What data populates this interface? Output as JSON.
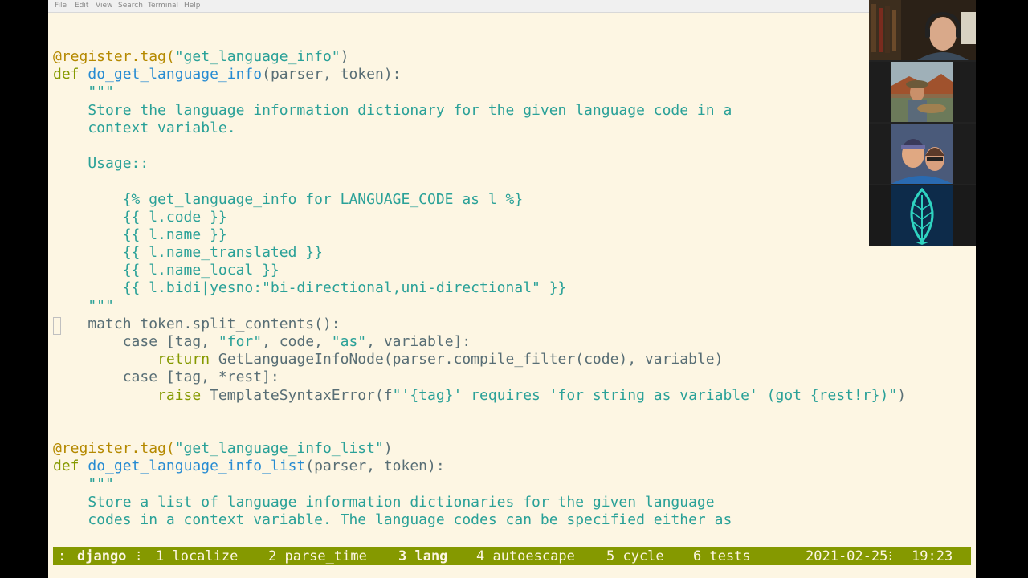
{
  "menu": [
    "File",
    "Edit",
    "View",
    "Search",
    "Terminal",
    "Help"
  ],
  "code_lines": [
    [
      {
        "t": "@register.tag(",
        "c": "dec"
      },
      {
        "t": "\"get_language_info\"",
        "c": "str"
      },
      {
        "t": ")",
        "c": ""
      }
    ],
    [
      {
        "t": "def ",
        "c": "kw"
      },
      {
        "t": "do_get_language_info",
        "c": "fn"
      },
      {
        "t": "(parser, token):",
        "c": ""
      }
    ],
    [
      {
        "t": "    \"\"\"",
        "c": "doc"
      }
    ],
    [
      {
        "t": "    Store the language information dictionary for the given language code in a",
        "c": "doc"
      }
    ],
    [
      {
        "t": "    context variable.",
        "c": "doc"
      }
    ],
    [
      {
        "t": "",
        "c": ""
      }
    ],
    [
      {
        "t": "    Usage::",
        "c": "doc"
      }
    ],
    [
      {
        "t": "",
        "c": ""
      }
    ],
    [
      {
        "t": "        {% get_language_info for LANGUAGE_CODE as l %}",
        "c": "doc"
      }
    ],
    [
      {
        "t": "        {{ l.code }}",
        "c": "doc"
      }
    ],
    [
      {
        "t": "        {{ l.name }}",
        "c": "doc"
      }
    ],
    [
      {
        "t": "        {{ l.name_translated }}",
        "c": "doc"
      }
    ],
    [
      {
        "t": "        {{ l.name_local }}",
        "c": "doc"
      }
    ],
    [
      {
        "t": "        {{ l.bidi|yesno:\"bi-directional,uni-directional\" }}",
        "c": "doc"
      }
    ],
    [
      {
        "t": "    \"\"\"",
        "c": "doc"
      }
    ],
    [
      {
        "t": "    match token.split_contents():",
        "c": ""
      }
    ],
    [
      {
        "t": "        case [tag, ",
        "c": ""
      },
      {
        "t": "\"for\"",
        "c": "str"
      },
      {
        "t": ", code, ",
        "c": ""
      },
      {
        "t": "\"as\"",
        "c": "str"
      },
      {
        "t": ", variable]:",
        "c": ""
      }
    ],
    [
      {
        "t": "            ",
        "c": ""
      },
      {
        "t": "return",
        "c": "kw"
      },
      {
        "t": " GetLanguageInfoNode(parser.compile_filter(code), variable)",
        "c": ""
      }
    ],
    [
      {
        "t": "        case [tag, *rest]:",
        "c": ""
      }
    ],
    [
      {
        "t": "            ",
        "c": ""
      },
      {
        "t": "raise",
        "c": "kw"
      },
      {
        "t": " TemplateSyntaxError(f",
        "c": ""
      },
      {
        "t": "\"'{tag}' requires 'for string as variable' (got {rest!r})\"",
        "c": "str"
      },
      {
        "t": ")",
        "c": ""
      }
    ],
    [
      {
        "t": "",
        "c": ""
      }
    ],
    [
      {
        "t": "",
        "c": ""
      }
    ],
    [
      {
        "t": "@register.tag(",
        "c": "dec"
      },
      {
        "t": "\"get_language_info_list\"",
        "c": "str"
      },
      {
        "t": ")",
        "c": ""
      }
    ],
    [
      {
        "t": "def ",
        "c": "kw"
      },
      {
        "t": "do_get_language_info_list",
        "c": "fn"
      },
      {
        "t": "(parser, token):",
        "c": ""
      }
    ],
    [
      {
        "t": "    \"\"\"",
        "c": "doc"
      }
    ],
    [
      {
        "t": "    Store a list of language information dictionaries for the given language",
        "c": "doc"
      }
    ],
    [
      {
        "t": "    codes in a context variable. The language codes can be specified either as",
        "c": "doc"
      }
    ]
  ],
  "status": {
    "prefix": ":",
    "session": "django",
    "sep": "⁝",
    "windows": [
      {
        "label": "1 localize",
        "active": false
      },
      {
        "label": "2 parse_time",
        "active": false
      },
      {
        "label": "3 lang",
        "active": true
      },
      {
        "label": "4 autoescape",
        "active": false
      },
      {
        "label": "5 cycle",
        "active": false
      },
      {
        "label": "6 tests",
        "active": false
      }
    ],
    "date": "2021-02-25",
    "time": "19:23"
  },
  "colors": {
    "background": "#fdf6e3",
    "status_bar": "#859900",
    "keyword": "#859900",
    "function": "#268bd2",
    "string": "#2aa198",
    "decorator": "#b58900"
  }
}
